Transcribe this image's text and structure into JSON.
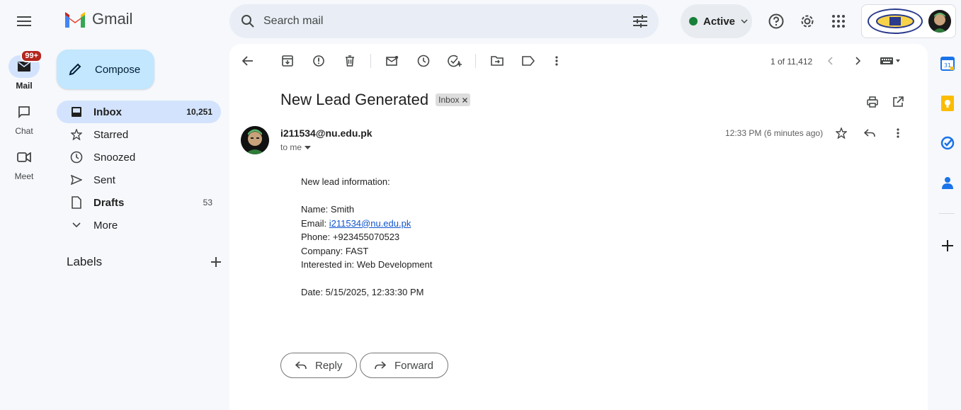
{
  "app": {
    "name": "Gmail"
  },
  "search": {
    "placeholder": "Search mail"
  },
  "status": {
    "label": "Active",
    "color": "#188038"
  },
  "rail": {
    "mail": {
      "label": "Mail",
      "badge": "99+"
    },
    "chat": {
      "label": "Chat"
    },
    "meet": {
      "label": "Meet"
    }
  },
  "compose": {
    "label": "Compose"
  },
  "nav": [
    {
      "label": "Inbox",
      "count": "10,251",
      "icon": "inbox-icon"
    },
    {
      "label": "Starred",
      "count": "",
      "icon": "star-icon"
    },
    {
      "label": "Snoozed",
      "count": "",
      "icon": "clock-icon"
    },
    {
      "label": "Sent",
      "count": "",
      "icon": "send-icon"
    },
    {
      "label": "Drafts",
      "count": "53",
      "icon": "draft-icon"
    },
    {
      "label": "More",
      "count": "",
      "icon": "chevron-down-icon"
    }
  ],
  "labels": {
    "title": "Labels"
  },
  "pager": {
    "text": "1 of 11,412"
  },
  "email": {
    "subject": "New Lead Generated",
    "label_chip": "Inbox",
    "sender": "i211534@nu.edu.pk",
    "recipient": "to me",
    "time": "12:33 PM (6 minutes ago)",
    "body": {
      "intro": "New lead information:",
      "name": "Name: Smith",
      "email_prefix": "Email: ",
      "email_link": "i211534@nu.edu.pk",
      "phone": "Phone: +923455070523",
      "company": "Company: FAST",
      "interest": "Interested in: Web Development",
      "date": "Date: 5/15/2025, 12:33:30 PM"
    }
  },
  "actions": {
    "reply": "Reply",
    "forward": "Forward"
  },
  "colors": {
    "accent": "#c2e7ff",
    "selected": "#d3e3fd",
    "background": "#f6f8fc",
    "link": "#1155cc",
    "badge": "#b3261e"
  }
}
